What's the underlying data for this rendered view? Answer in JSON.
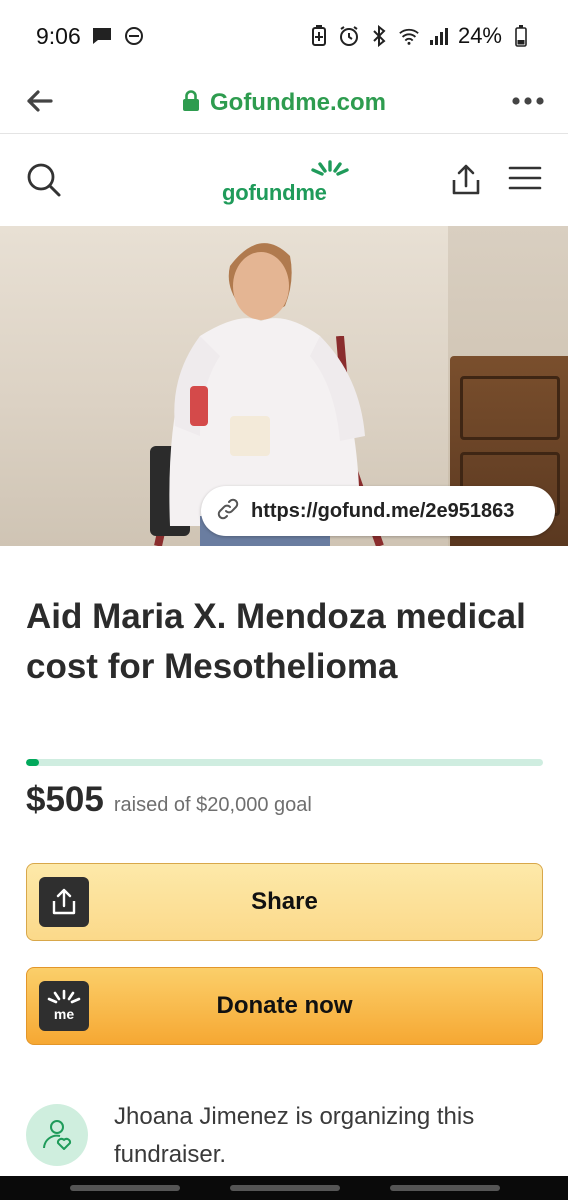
{
  "status_bar": {
    "time": "9:06",
    "battery": "24%",
    "icons": [
      "chat-bubble-icon",
      "dnd-icon",
      "battery-saver-icon",
      "alarm-icon",
      "bluetooth-icon",
      "wifi-icon",
      "signal-icon",
      "battery-icon"
    ]
  },
  "browser": {
    "url": "Gofundme.com",
    "icons": [
      "back-arrow-icon",
      "lock-icon",
      "more-icon"
    ]
  },
  "header": {
    "logo_text": "gofundme",
    "icons": [
      "search-icon",
      "share-icon",
      "menu-icon"
    ]
  },
  "hero": {
    "link": "https://gofund.me/2e951863",
    "icons": [
      "link-icon"
    ]
  },
  "campaign": {
    "title": "Aid Maria X. Mendoza medical cost for Mesothelioma",
    "raised": "$505",
    "goal_text": "raised of $20,000 goal",
    "progress_fraction": 0.025
  },
  "actions": {
    "share_label": "Share",
    "donate_label": "Donate now",
    "donate_icon_text": "me"
  },
  "organizer": {
    "text": "Jhoana Jimenez is organizing this fundraiser.",
    "icons": [
      "organizer-heart-icon"
    ]
  },
  "colors": {
    "brand_green": "#02a95c",
    "url_green": "#2e9c4f",
    "progress_track": "#cfede0",
    "share_button": "#fbd98a",
    "donate_button": "#f6a833"
  }
}
